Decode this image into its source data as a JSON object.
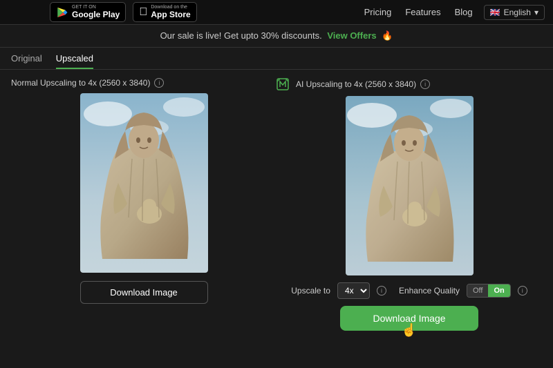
{
  "navbar": {
    "google_play_sub": "GET IT ON",
    "google_play_label": "Google Play",
    "appstore_sub": "Download on the",
    "appstore_label": "App Store",
    "links": [
      {
        "label": "Pricing",
        "id": "pricing"
      },
      {
        "label": "Features",
        "id": "features"
      },
      {
        "label": "Blog",
        "id": "blog"
      }
    ],
    "lang_flag": "🇬🇧",
    "lang_label": "English"
  },
  "sale_banner": {
    "text": "Our sale is live! Get upto 30% discounts.",
    "link_label": "View Offers",
    "emoji": "🔥"
  },
  "tabs": [
    {
      "label": "Original",
      "active": false
    },
    {
      "label": "Upscaled",
      "active": true
    }
  ],
  "left_panel": {
    "header": "Normal Upscaling to 4x (2560 x 3840)",
    "download_label": "Download Image"
  },
  "right_panel": {
    "header": "AI Upscaling to 4x (2560 x 3840)",
    "upscale_label": "Upscale to",
    "upscale_value": "4x",
    "enhance_label": "Enhance Quality",
    "toggle_off": "Off",
    "toggle_on": "On",
    "download_label": "Download Image"
  }
}
